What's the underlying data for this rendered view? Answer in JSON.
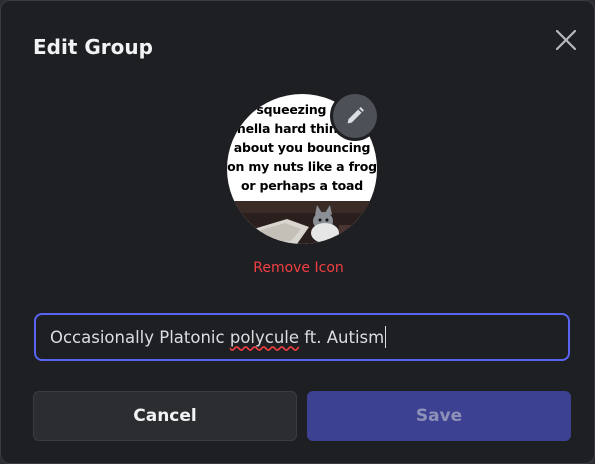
{
  "dialog": {
    "title": "Edit Group",
    "close_icon": "close-icon",
    "edit_icon": "pencil-icon"
  },
  "group_icon": {
    "caption_lines": [
      "'squeezing my",
      "hella hard thinking",
      "about you bouncing",
      "on my nuts like a frog",
      "or perhaps a toad"
    ],
    "remove_label": "Remove Icon"
  },
  "name_field": {
    "before": "Occasionally Platonic ",
    "misspelled": "polycule",
    "after": " ft. Autism"
  },
  "buttons": {
    "cancel": "Cancel",
    "save": "Save"
  },
  "colors": {
    "accent": "#5865f2",
    "danger": "#f23f43",
    "save_bg": "#3c4291"
  }
}
